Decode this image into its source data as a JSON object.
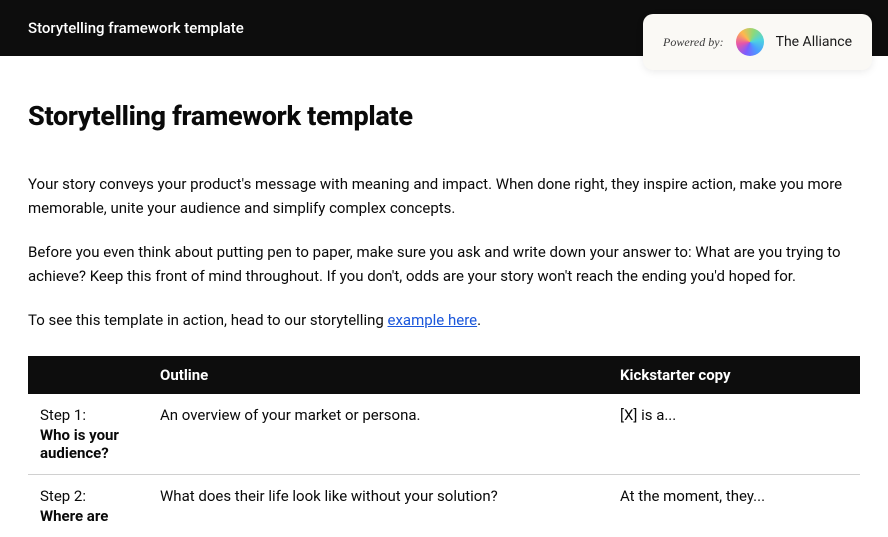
{
  "topbar": {
    "title": "Storytelling framework template"
  },
  "badge": {
    "powered_by": "Powered by:",
    "brand": "The Alliance"
  },
  "page": {
    "title": "Storytelling framework template",
    "para1": "Your story conveys your product's message with meaning and impact. When done right, they inspire action, make you more memorable, unite your audience and simplify complex concepts.",
    "para2": "Before you even think about putting pen to paper, make sure you ask and write down your answer to: What are you trying to achieve? Keep this front of mind throughout. If you don't, odds are your story won't reach the ending you'd hoped for.",
    "para3_prefix": "To see this template in action, head to our storytelling ",
    "para3_link": "example here",
    "para3_suffix": "."
  },
  "table": {
    "headers": {
      "col1": "",
      "col2": "Outline",
      "col3": "Kickstarter copy"
    },
    "rows": [
      {
        "step": "Step 1:",
        "question": "Who is your audience?",
        "outline": "An overview of your market or persona.",
        "kickstarter": "[X] is a..."
      },
      {
        "step": "Step 2:",
        "question": "Where are",
        "outline": "What does their life look like without your solution?",
        "kickstarter": "At the moment, they..."
      }
    ]
  }
}
